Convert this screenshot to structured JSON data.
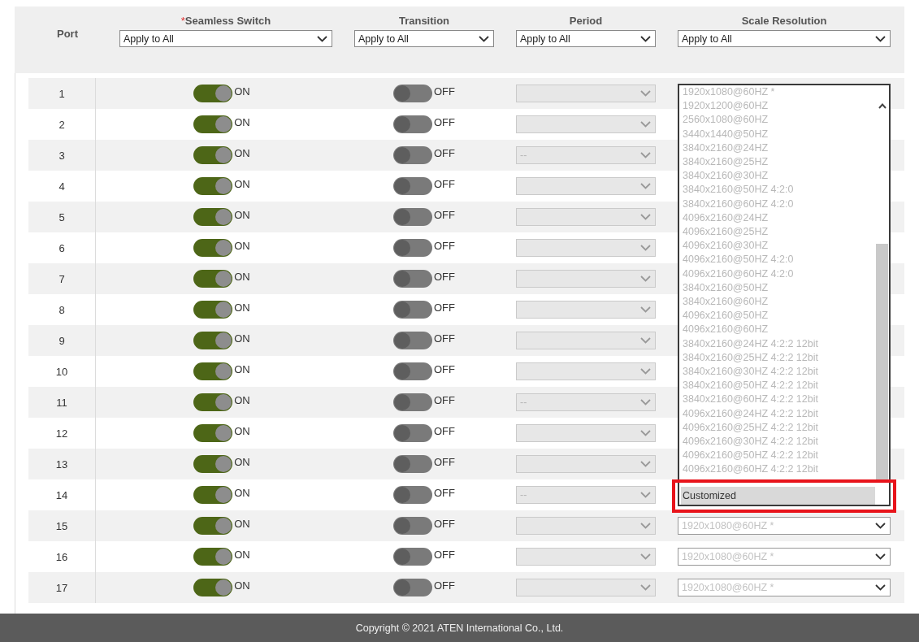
{
  "table": {
    "columns": [
      {
        "label": "Port"
      },
      {
        "required_mark": "*",
        "label": "Seamless Switch",
        "apply_all": "Apply to All"
      },
      {
        "label": "Transition",
        "apply_all": "Apply to All"
      },
      {
        "label": "Period",
        "apply_all": "Apply to All"
      },
      {
        "label": "Scale Resolution",
        "apply_all": "Apply to All"
      }
    ],
    "rows": [
      {
        "port": "1",
        "seamless": {
          "on": true,
          "label": "ON"
        },
        "transition": {
          "on": false,
          "label": "OFF"
        },
        "period": {
          "disabled": true
        }
      },
      {
        "port": "2",
        "seamless": {
          "on": true,
          "label": "ON"
        },
        "transition": {
          "on": false,
          "label": "OFF"
        },
        "period": {
          "disabled": true
        }
      },
      {
        "port": "3",
        "seamless": {
          "on": true,
          "label": "ON"
        },
        "transition": {
          "on": false,
          "label": "OFF"
        },
        "period": {
          "disabled": true,
          "value": "--"
        }
      },
      {
        "port": "4",
        "seamless": {
          "on": true,
          "label": "ON"
        },
        "transition": {
          "on": false,
          "label": "OFF"
        },
        "period": {
          "disabled": true
        }
      },
      {
        "port": "5",
        "seamless": {
          "on": true,
          "label": "ON"
        },
        "transition": {
          "on": false,
          "label": "OFF"
        },
        "period": {
          "disabled": true
        }
      },
      {
        "port": "6",
        "seamless": {
          "on": true,
          "label": "ON"
        },
        "transition": {
          "on": false,
          "label": "OFF"
        },
        "period": {
          "disabled": true
        }
      },
      {
        "port": "7",
        "seamless": {
          "on": true,
          "label": "ON"
        },
        "transition": {
          "on": false,
          "label": "OFF"
        },
        "period": {
          "disabled": true
        }
      },
      {
        "port": "8",
        "seamless": {
          "on": true,
          "label": "ON"
        },
        "transition": {
          "on": false,
          "label": "OFF"
        },
        "period": {
          "disabled": true
        }
      },
      {
        "port": "9",
        "seamless": {
          "on": true,
          "label": "ON"
        },
        "transition": {
          "on": false,
          "label": "OFF"
        },
        "period": {
          "disabled": true
        }
      },
      {
        "port": "10",
        "seamless": {
          "on": true,
          "label": "ON"
        },
        "transition": {
          "on": false,
          "label": "OFF"
        },
        "period": {
          "disabled": true
        }
      },
      {
        "port": "11",
        "seamless": {
          "on": true,
          "label": "ON"
        },
        "transition": {
          "on": false,
          "label": "OFF"
        },
        "period": {
          "disabled": true,
          "value": "--"
        }
      },
      {
        "port": "12",
        "seamless": {
          "on": true,
          "label": "ON"
        },
        "transition": {
          "on": false,
          "label": "OFF"
        },
        "period": {
          "disabled": true
        }
      },
      {
        "port": "13",
        "seamless": {
          "on": true,
          "label": "ON"
        },
        "transition": {
          "on": false,
          "label": "OFF"
        },
        "period": {
          "disabled": true
        }
      },
      {
        "port": "14",
        "seamless": {
          "on": true,
          "label": "ON"
        },
        "transition": {
          "on": false,
          "label": "OFF"
        },
        "period": {
          "disabled": true,
          "value": "--"
        }
      },
      {
        "port": "15",
        "seamless": {
          "on": true,
          "label": "ON"
        },
        "transition": {
          "on": false,
          "label": "OFF"
        },
        "period": {
          "disabled": true
        },
        "scale_resolution": "1920x1080@60HZ *"
      },
      {
        "port": "16",
        "seamless": {
          "on": true,
          "label": "ON"
        },
        "transition": {
          "on": false,
          "label": "OFF"
        },
        "period": {
          "disabled": true
        },
        "scale_resolution": "1920x1080@60HZ *"
      },
      {
        "port": "17",
        "seamless": {
          "on": true,
          "label": "ON"
        },
        "transition": {
          "on": false,
          "label": "OFF"
        },
        "period": {
          "disabled": true
        },
        "scale_resolution": "1920x1080@60HZ *"
      }
    ],
    "scale_dropdown": {
      "options": [
        {
          "label": "1920x1080@60HZ *",
          "selected": false,
          "framed": false
        },
        {
          "label": "1920x1200@60HZ",
          "selected": false,
          "framed": false
        },
        {
          "label": "2560x1080@60HZ",
          "selected": false,
          "framed": false
        },
        {
          "label": "3440x1440@50HZ",
          "selected": false,
          "framed": false
        },
        {
          "label": "3840x2160@24HZ",
          "selected": false,
          "framed": false
        },
        {
          "label": "3840x2160@25HZ",
          "selected": false,
          "framed": false
        },
        {
          "label": "3840x2160@30HZ",
          "selected": false,
          "framed": false
        },
        {
          "label": "3840x2160@50HZ 4:2:0",
          "selected": false,
          "framed": false
        },
        {
          "label": "3840x2160@60HZ 4:2:0",
          "selected": false,
          "framed": false
        },
        {
          "label": "4096x2160@24HZ",
          "selected": false,
          "framed": false
        },
        {
          "label": "4096x2160@25HZ",
          "selected": false,
          "framed": false
        },
        {
          "label": "4096x2160@30HZ",
          "selected": false,
          "framed": false
        },
        {
          "label": "4096x2160@50HZ 4:2:0",
          "selected": false,
          "framed": false
        },
        {
          "label": "4096x2160@60HZ 4:2:0",
          "selected": false,
          "framed": false
        },
        {
          "label": "3840x2160@50HZ",
          "selected": false,
          "framed": false
        },
        {
          "label": "3840x2160@60HZ",
          "selected": false,
          "framed": false
        },
        {
          "label": "4096x2160@50HZ",
          "selected": false,
          "framed": false
        },
        {
          "label": "4096x2160@60HZ",
          "selected": false,
          "framed": false
        },
        {
          "label": "3840x2160@24HZ 4:2:2 12bit",
          "selected": false,
          "framed": false
        },
        {
          "label": "3840x2160@25HZ 4:2:2 12bit",
          "selected": false,
          "framed": false
        },
        {
          "label": "3840x2160@30HZ 4:2:2 12bit",
          "selected": false,
          "framed": false
        },
        {
          "label": "3840x2160@50HZ 4:2:2 12bit",
          "selected": false,
          "framed": false
        },
        {
          "label": "3840x2160@60HZ 4:2:2 12bit",
          "selected": false,
          "framed": false
        },
        {
          "label": "4096x2160@24HZ 4:2:2 12bit",
          "selected": false,
          "framed": false
        },
        {
          "label": "4096x2160@25HZ 4:2:2 12bit",
          "selected": false,
          "framed": false
        },
        {
          "label": "4096x2160@30HZ 4:2:2 12bit",
          "selected": false,
          "framed": false
        },
        {
          "label": "4096x2160@50HZ 4:2:2 12bit",
          "selected": false,
          "framed": false
        },
        {
          "label": "4096x2160@60HZ 4:2:2 12bit",
          "selected": false,
          "framed": false
        },
        {
          "label": "Customized",
          "selected": true,
          "framed": true
        }
      ]
    }
  },
  "footer": {
    "text": "Copyright © 2021 ATEN International Co., Ltd."
  }
}
